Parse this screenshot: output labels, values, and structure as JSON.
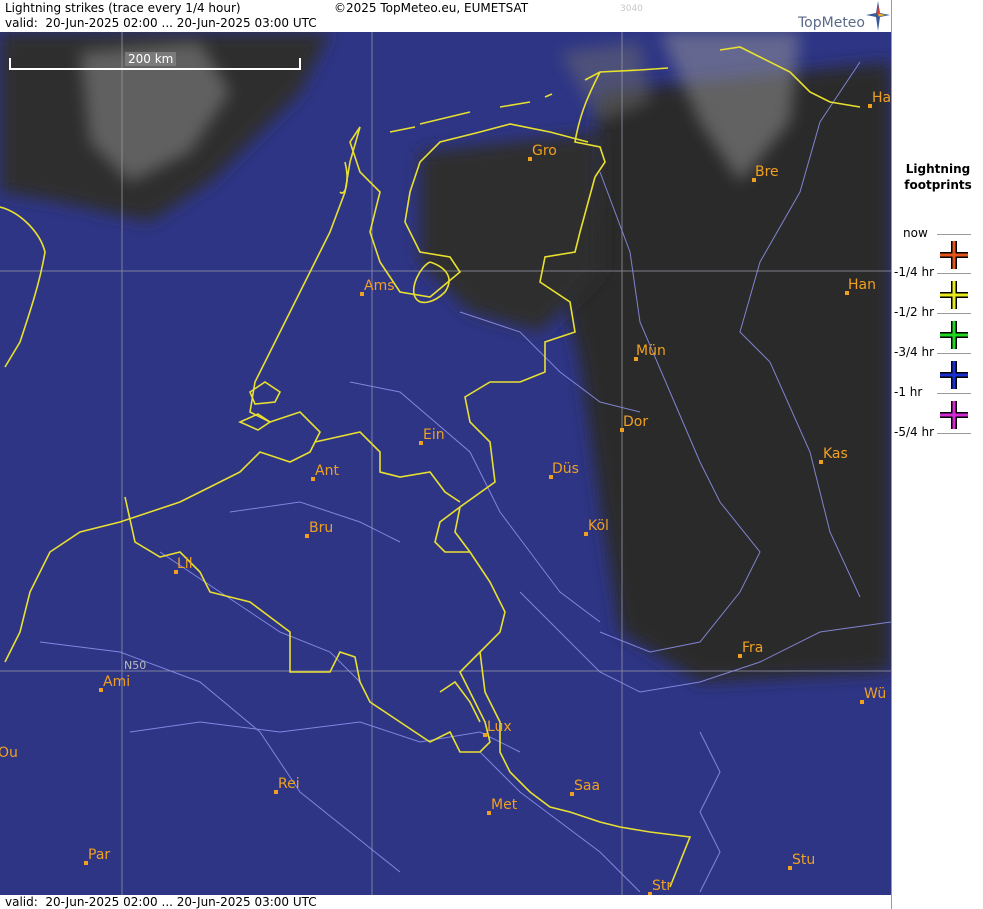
{
  "header": {
    "title": "Lightning strikes (trace every 1/4 hour)",
    "copyright": "©2025 TopMeteo.eu, EUMETSAT",
    "faint_code": "3040",
    "valid": "valid:  20-Jun-2025 02:00 ... 20-Jun-2025 03:00 UTC",
    "logo": "TopMeteo"
  },
  "footer": {
    "valid": "valid:  20-Jun-2025 02:00 ... 20-Jun-2025 03:00 UTC"
  },
  "map": {
    "scale_label": "200 km",
    "grid_label": "N50",
    "cities": [
      "Gro",
      "Bre",
      "Han",
      "Ams",
      "Mün",
      "Dor",
      "Ein",
      "Kas",
      "Ant",
      "Düs",
      "Bru",
      "Köl",
      "Lil",
      "Fra",
      "Ami",
      "Wü",
      "Lux",
      "Saa",
      "Rei",
      "Ou",
      "Met",
      "Stu",
      "Par",
      "Str",
      "Ha"
    ]
  },
  "legend": {
    "title_line1": "Lightning",
    "title_line2": "footprints",
    "labels": [
      "now",
      "-1/4 hr",
      "-1/2 hr",
      "-3/4 hr",
      "-1 hr",
      "-5/4 hr"
    ],
    "colors": {
      "now": "#e2541a",
      "q1": "#e8e81e",
      "q2": "#22d622",
      "q3": "#1a2fd0",
      "q4": "#d02ad0"
    }
  }
}
